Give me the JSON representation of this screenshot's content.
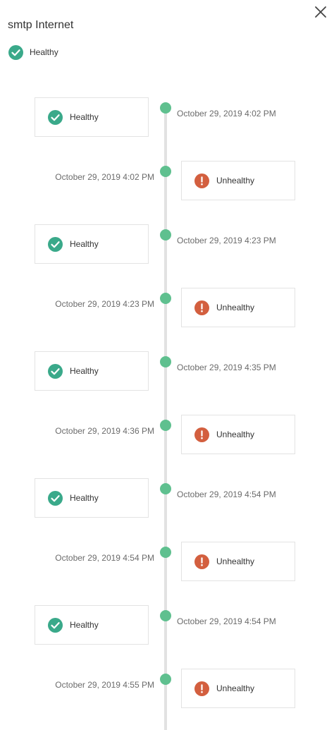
{
  "header": {
    "title": "smtp Internet",
    "close_icon": "close-icon"
  },
  "status": {
    "label": "Healthy",
    "icon": "check-circle-icon"
  },
  "colors": {
    "healthy": "#3aa98a",
    "unhealthy": "#d35f3f",
    "timeline_dot": "#5fc08f",
    "timeline_line": "#e2e2e2"
  },
  "timeline": [
    {
      "status": "healthy",
      "label": "Healthy",
      "timestamp": "October 29, 2019 4:02 PM"
    },
    {
      "status": "unhealthy",
      "label": "Unhealthy",
      "timestamp": "October 29, 2019 4:02 PM"
    },
    {
      "status": "healthy",
      "label": "Healthy",
      "timestamp": "October 29, 2019 4:23 PM"
    },
    {
      "status": "unhealthy",
      "label": "Unhealthy",
      "timestamp": "October 29, 2019 4:23 PM"
    },
    {
      "status": "healthy",
      "label": "Healthy",
      "timestamp": "October 29, 2019 4:35 PM"
    },
    {
      "status": "unhealthy",
      "label": "Unhealthy",
      "timestamp": "October 29, 2019 4:36 PM"
    },
    {
      "status": "healthy",
      "label": "Healthy",
      "timestamp": "October 29, 2019 4:54 PM"
    },
    {
      "status": "unhealthy",
      "label": "Unhealthy",
      "timestamp": "October 29, 2019 4:54 PM"
    },
    {
      "status": "healthy",
      "label": "Healthy",
      "timestamp": "October 29, 2019 4:54 PM"
    },
    {
      "status": "unhealthy",
      "label": "Unhealthy",
      "timestamp": "October 29, 2019 4:55 PM"
    }
  ]
}
